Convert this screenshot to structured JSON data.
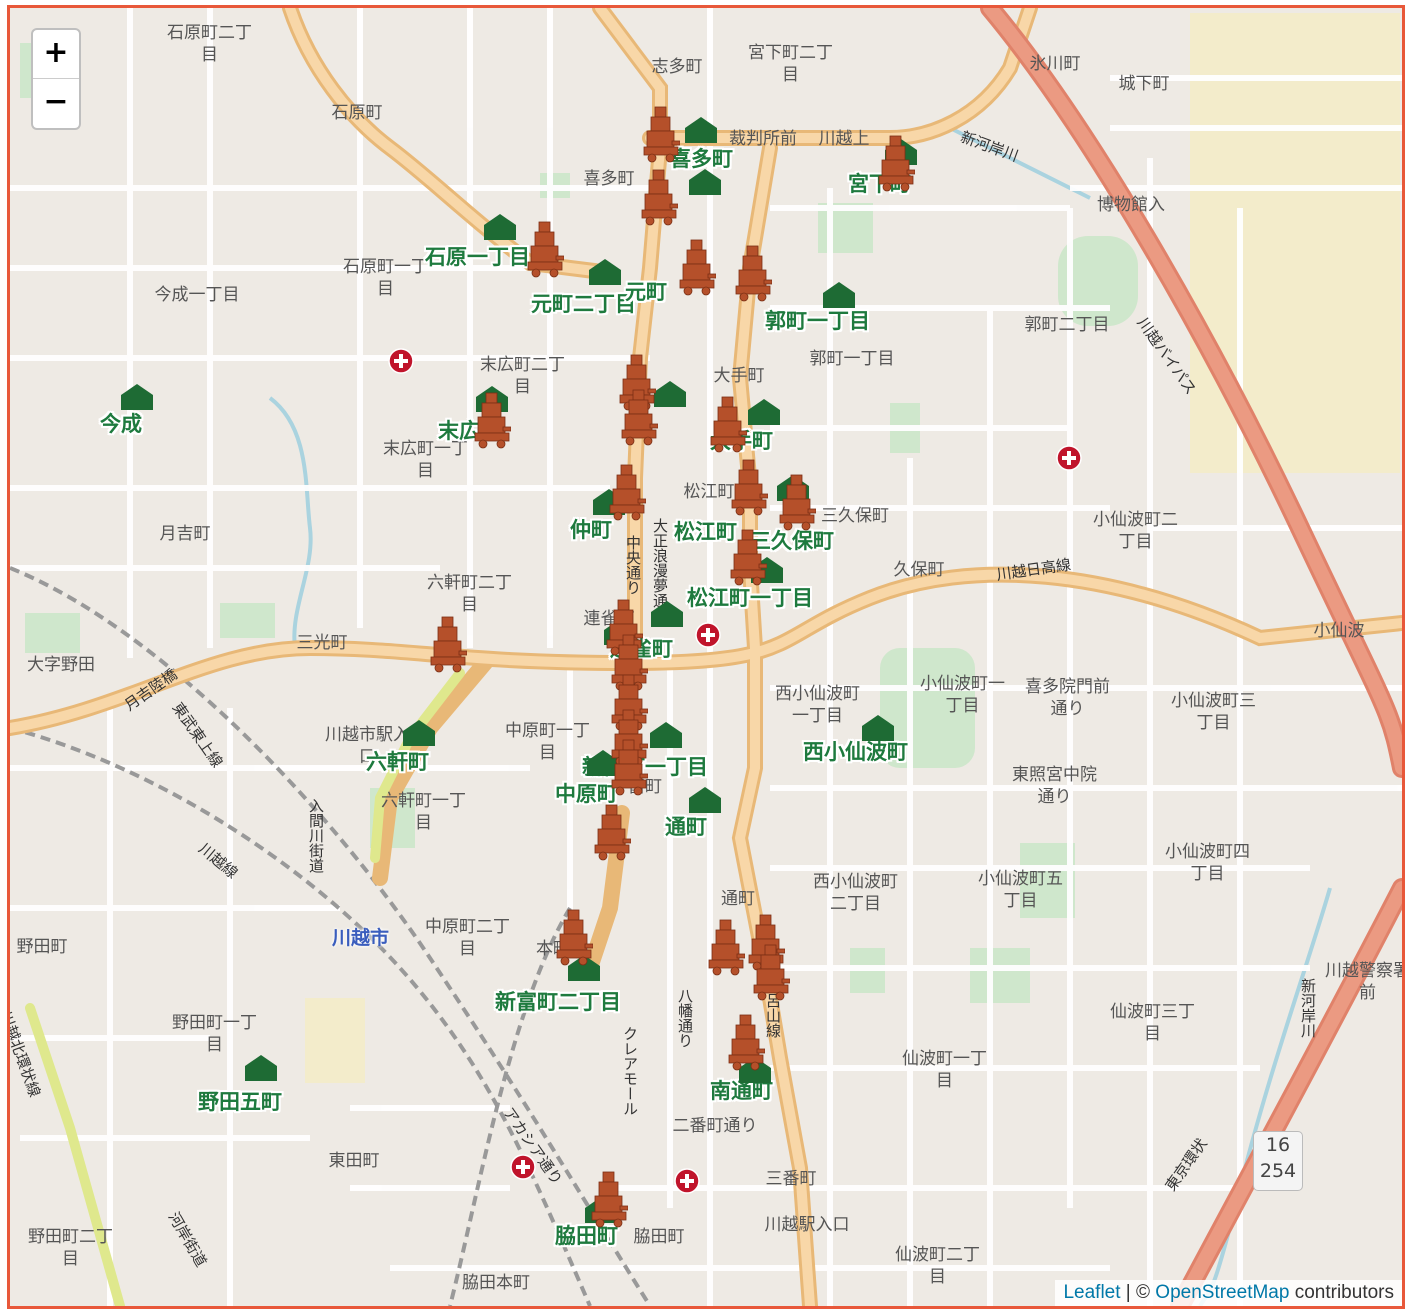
{
  "map": {
    "controls": {
      "zoom_in": "+",
      "zoom_out": "−"
    },
    "attribution": {
      "leaflet": "Leaflet",
      "separator": "|",
      "copyright": "©",
      "osm": "OpenStreetMap",
      "contributors": "contributors"
    },
    "route_shield": {
      "top": "16",
      "bottom": "254"
    },
    "station": "川越市",
    "area_labels": [
      "石原町二丁目",
      "石原町",
      "石原町一丁目",
      "今成一丁目",
      "末広町二丁目",
      "末広町一丁目",
      "月吉町",
      "六軒町二丁目",
      "大字野田",
      "三光町",
      "川越市駅入口",
      "六軒町一丁目",
      "中原町一丁目",
      "中原町二丁目",
      "野田町",
      "野田町一丁目",
      "東田町",
      "野田町二丁目",
      "脇田本町",
      "脇田町",
      "本町",
      "志多町",
      "宮下町二丁目",
      "裁判所前",
      "川越上",
      "喜多町",
      "氷川町",
      "城下町",
      "博物館入",
      "郭町二丁目",
      "郭町一丁目",
      "大手町",
      "松江町",
      "久保町",
      "三久保町",
      "小仙波町二丁目",
      "西小仙波町一丁目",
      "小仙波町一丁目",
      "喜多院門前通り",
      "小仙波町三丁目",
      "東照宮中院通り",
      "小仙波町四丁目",
      "西小仙波町二丁目",
      "小仙波町五丁目",
      "仙波町三丁目",
      "仙波町一丁目",
      "三番町",
      "仙波町二丁目",
      "川越駅入口",
      "通町",
      "富町",
      "小仙波",
      "川越警察署前",
      "二番町通り",
      "連雀町"
    ],
    "road_labels": [
      "川越日高線",
      "新河岸川",
      "川越バイパス",
      "月吉陸橋",
      "東武東上線",
      "川越線",
      "入間川街道",
      "河岸街道",
      "中央通り",
      "大正浪漫夢通り",
      "毛呂山線",
      "クレアモール",
      "八幡通り",
      "アカシア通り",
      "川越北環状線",
      "東京環状",
      "新河岸川"
    ],
    "stop_labels": [
      "今成",
      "石原一丁目",
      "元町二丁目",
      "元町",
      "喜多町",
      "郭町一丁目",
      "末広",
      "仲町",
      "松江町",
      "三久保町",
      "松江町一丁目",
      "宮下町",
      "六軒町",
      "新富町一丁目",
      "中原町",
      "通町",
      "西小仙波町",
      "新富町二丁目",
      "野田五町",
      "南通町",
      "脇田町",
      "大手町",
      "連雀町"
    ],
    "marker_types": {
      "float": "festival-float-icon",
      "stop": "bus-stop-icon",
      "hospital": "hospital-icon"
    },
    "colors": {
      "float": "#b5502a",
      "stop": "#1e6b34",
      "hospital": "#c0142b",
      "major_road": "#f6c47e",
      "trunk_road": "#eb9a82",
      "border": "#e8583a"
    }
  }
}
